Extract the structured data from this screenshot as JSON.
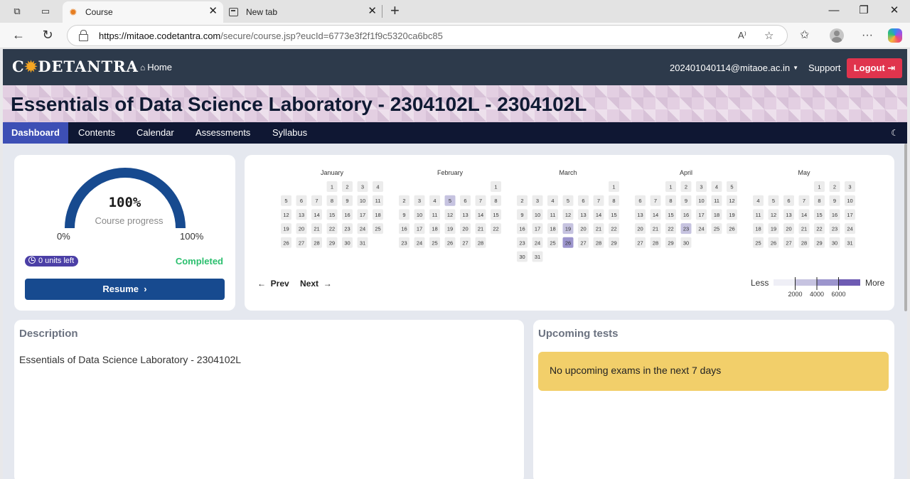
{
  "browser": {
    "tabs": [
      {
        "title": "Course",
        "active": true
      },
      {
        "title": "New tab",
        "active": false
      }
    ],
    "url_host": "https://mitaoe.codetantra.com",
    "url_path": "/secure/course.jsp?eucId=6773e3f2f1f9c5320ca6bc85"
  },
  "header": {
    "logo_a": "C",
    "logo_b": "DETANTRA",
    "home_label": "Home",
    "user_email": "202401040114@mitaoe.ac.in",
    "support_label": "Support",
    "logout_label": "Logout"
  },
  "course": {
    "title": "Essentials of Data Science Laboratory - 2304102L - 2304102L"
  },
  "subnav": {
    "items": [
      "Dashboard",
      "Contents",
      "Calendar",
      "Assessments",
      "Syllabus"
    ]
  },
  "progress": {
    "value_label": "100%",
    "value": 1.0,
    "caption": "Course progress",
    "min_label": "0%",
    "max_label": "100%",
    "units_left": "0 units left",
    "status": "Completed",
    "resume_label": "Resume"
  },
  "calendar": {
    "months": [
      {
        "name": "January",
        "first_weekday": 3,
        "days": 31
      },
      {
        "name": "February",
        "first_weekday": 6,
        "days": 28
      },
      {
        "name": "March",
        "first_weekday": 6,
        "days": 31
      },
      {
        "name": "April",
        "first_weekday": 2,
        "days": 30
      },
      {
        "name": "May",
        "first_weekday": 4,
        "days": 31
      }
    ],
    "highlights": [
      {
        "month": 1,
        "day": 5,
        "level": 1
      },
      {
        "month": 2,
        "day": 19,
        "level": 1
      },
      {
        "month": 2,
        "day": 26,
        "level": 2
      },
      {
        "month": 3,
        "day": 23,
        "level": 1
      }
    ],
    "prev_label": "Prev",
    "next_label": "Next",
    "legend": {
      "less_label": "Less",
      "more_label": "More",
      "ticks": [
        "2000",
        "4000",
        "6000"
      ],
      "colors": [
        "#efeff6",
        "#c6c3e0",
        "#9c95cd",
        "#6e5bb3"
      ]
    }
  },
  "description": {
    "heading": "Description",
    "text": "Essentials of Data Science Laboratory - 2304102L"
  },
  "upcoming": {
    "heading": "Upcoming tests",
    "message": "No upcoming exams in the next 7 days"
  }
}
